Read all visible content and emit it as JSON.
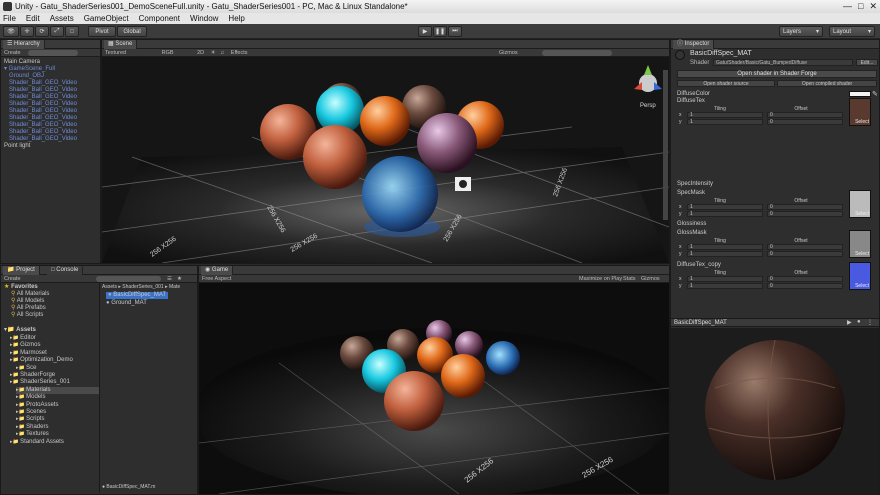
{
  "window": {
    "title": "Unity - Gatu_ShaderSeries001_DemoSceneFull.unity - Gatu_ShaderSeries001 - PC, Mac & Linux Standalone*"
  },
  "menu": [
    "File",
    "Edit",
    "Assets",
    "GameObject",
    "Component",
    "Window",
    "Help"
  ],
  "toolbar": {
    "pivot": "Pivot",
    "global": "Global",
    "layers": "Layers",
    "layout": "Layout"
  },
  "hierarchy": {
    "tab": "Hierarchy",
    "create": "Create",
    "items": [
      {
        "label": "Main Camera",
        "indent": 0,
        "blue": false
      },
      {
        "label": "▾ GameScene_Full",
        "indent": 0,
        "blue": true
      },
      {
        "label": "Ground_OBJ",
        "indent": 1,
        "blue": true
      },
      {
        "label": "Shader_Ball_GEO_Video",
        "indent": 1,
        "blue": true
      },
      {
        "label": "Shader_Ball_GEO_Video",
        "indent": 1,
        "blue": true
      },
      {
        "label": "Shader_Ball_GEO_Video",
        "indent": 1,
        "blue": true
      },
      {
        "label": "Shader_Ball_GEO_Video",
        "indent": 1,
        "blue": true
      },
      {
        "label": "Shader_Ball_GEO_Video",
        "indent": 1,
        "blue": true
      },
      {
        "label": "Shader_Ball_GEO_Video",
        "indent": 1,
        "blue": true
      },
      {
        "label": "Shader_Ball_GEO_Video",
        "indent": 1,
        "blue": true
      },
      {
        "label": "Shader_Ball_GEO_Video",
        "indent": 1,
        "blue": true
      },
      {
        "label": "Shader_Ball_GEO_Video",
        "indent": 1,
        "blue": true
      },
      {
        "label": "Point light",
        "indent": 0,
        "blue": false
      }
    ]
  },
  "scene": {
    "tab": "Scene",
    "textured": "Textured",
    "rgb": "RGB",
    "mode2d": "2D",
    "effects": "Effects",
    "gizmos": "Gizmos",
    "persp": "Persp",
    "grid_labels": [
      "256 X256",
      "256 X256",
      "256 X256",
      "256 X256",
      "256 X256"
    ]
  },
  "project": {
    "tab": "Project",
    "console": "Console",
    "create": "Create",
    "favorites": "Favorites",
    "fav_items": [
      "All Materials",
      "All Models",
      "All Prefabs",
      "All Scripts"
    ],
    "assets": "Assets",
    "tree": [
      {
        "label": "Editor",
        "indent": 1
      },
      {
        "label": "Gizmos",
        "indent": 1
      },
      {
        "label": "Marmoset",
        "indent": 1
      },
      {
        "label": "Optimization_Demo",
        "indent": 1
      },
      {
        "label": "Sce",
        "indent": 2
      },
      {
        "label": "ShaderForge",
        "indent": 1
      },
      {
        "label": "ShaderSeries_001",
        "indent": 1
      },
      {
        "label": "Materials",
        "indent": 2
      },
      {
        "label": "Models",
        "indent": 2
      },
      {
        "label": "ProtoAssets",
        "indent": 2
      },
      {
        "label": "Scenes",
        "indent": 2
      },
      {
        "label": "Scripts",
        "indent": 2
      },
      {
        "label": "Shaders",
        "indent": 2
      },
      {
        "label": "Textures",
        "indent": 2
      },
      {
        "label": "Standard Assets",
        "indent": 1
      }
    ],
    "path": "Assets ▸ ShaderSeries_001 ▸ Mate",
    "files": [
      "BasicDiffSpec_MAT",
      "Ground_MAT"
    ],
    "footer": "BasicDiffSpec_MAT.m"
  },
  "game": {
    "tab": "Game",
    "aspect": "Free Aspect",
    "maximize": "Maximize on Play",
    "stats": "Stats",
    "gizmos": "Gizmos",
    "grid_labels": [
      "256 X256",
      "256 X256"
    ]
  },
  "inspector": {
    "tab": "Inspector",
    "material": "BasicDiffSpec_MAT",
    "shader_label": "Shader",
    "shader_value": "Gatu/Shader/Basic/Gatu_BumpedDiffuse",
    "edit": "Edit...",
    "open_forge": "Open shader in Shader Forge",
    "open_source": "Open shader source",
    "open_compiled": "Open compiled shader",
    "diffuse_color": "DiffuseColor",
    "diffuse_tex": "DiffuseTex",
    "spec_intensity": "SpecIntensity",
    "spec_mask": "SpecMask",
    "glossiness": "Glossiness",
    "gloss_mask": "GlossMask",
    "diffuse_tex_copy": "DiffuseTex_copy",
    "tiling": "Tiling",
    "offset": "Offset",
    "x": "x",
    "y": "y",
    "one": "1",
    "zero": "0",
    "select": "Select",
    "preview_title": "BasicDiffSpec_MAT"
  },
  "colors": {
    "accent": "#3a72c8",
    "scene_bg": "#151515",
    "panel": "#2e2e2e"
  }
}
